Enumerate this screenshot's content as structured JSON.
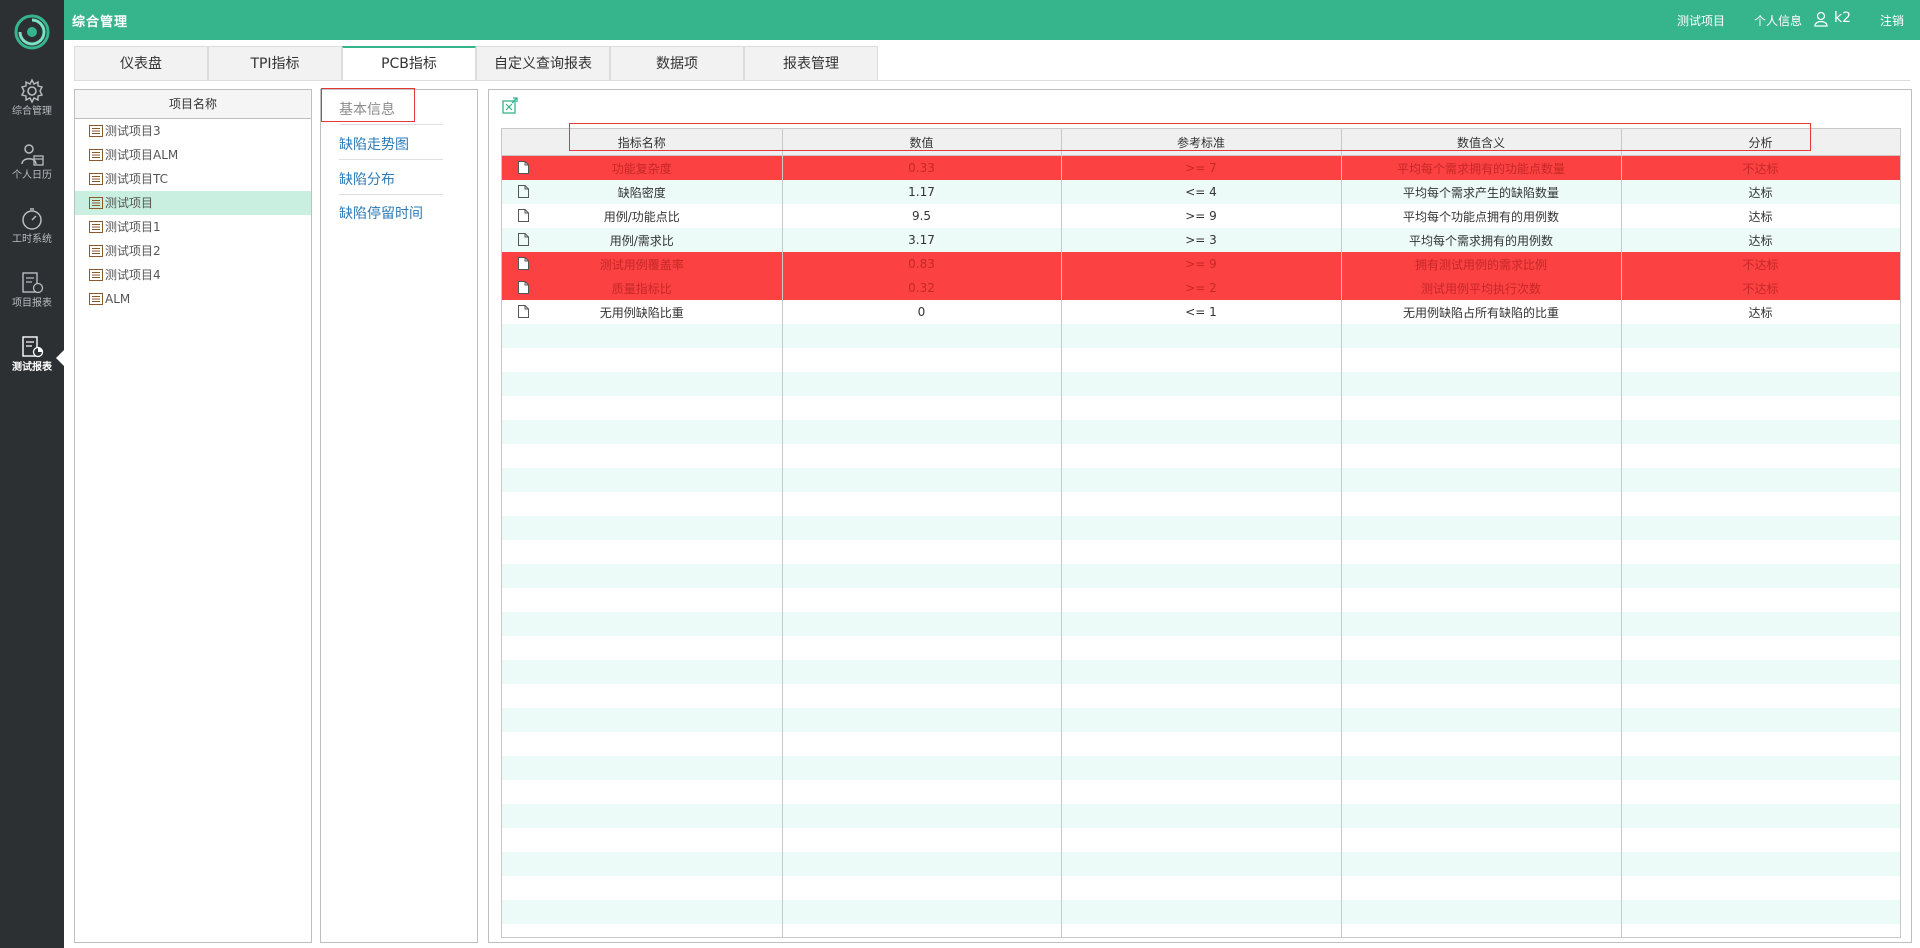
{
  "app": {
    "title": "综合管理"
  },
  "nav": {
    "items": [
      {
        "label": "综合管理",
        "icon": "gear-icon"
      },
      {
        "label": "个人日历",
        "icon": "person-calendar-icon"
      },
      {
        "label": "工时系统",
        "icon": "stopwatch-icon"
      },
      {
        "label": "项目报表",
        "icon": "project-report-icon"
      },
      {
        "label": "测试报表",
        "icon": "test-report-icon",
        "active": true
      }
    ]
  },
  "topbar": {
    "project": "测试项目",
    "profile": "个人信息",
    "username": "k2",
    "logout": "注销"
  },
  "tabs": [
    {
      "label": "仪表盘"
    },
    {
      "label": "TPI指标"
    },
    {
      "label": "PCB指标",
      "active": true
    },
    {
      "label": "自定义查询报表"
    },
    {
      "label": "数据项"
    },
    {
      "label": "报表管理"
    }
  ],
  "projects": {
    "header": "项目名称",
    "items": [
      "测试项目3",
      "测试项目ALM",
      "测试项目TC",
      "测试项目",
      "测试项目1",
      "测试项目2",
      "测试项目4",
      "ALM"
    ],
    "selected": "测试项目"
  },
  "submenu": {
    "items": [
      {
        "label": "基本信息",
        "current": true
      },
      {
        "label": "缺陷走势图"
      },
      {
        "label": "缺陷分布"
      },
      {
        "label": "缺陷停留时间"
      }
    ]
  },
  "table": {
    "columns": [
      "指标名称",
      "数值",
      "参考标准",
      "数值含义",
      "分析"
    ],
    "rows": [
      {
        "name": "功能复杂度",
        "value": "0.33",
        "standard": ">= 7",
        "meaning": "平均每个需求拥有的功能点数量",
        "analysis": "不达标",
        "fail": true
      },
      {
        "name": "缺陷密度",
        "value": "1.17",
        "standard": "<= 4",
        "meaning": "平均每个需求产生的缺陷数量",
        "analysis": "达标",
        "fail": false
      },
      {
        "name": "用例/功能点比",
        "value": "9.5",
        "standard": ">= 9",
        "meaning": "平均每个功能点拥有的用例数",
        "analysis": "达标",
        "fail": false
      },
      {
        "name": "用例/需求比",
        "value": "3.17",
        "standard": ">= 3",
        "meaning": "平均每个需求拥有的用例数",
        "analysis": "达标",
        "fail": false
      },
      {
        "name": "测试用例覆盖率",
        "value": "0.83",
        "standard": ">= 9",
        "meaning": "拥有测试用例的需求比例",
        "analysis": "不达标",
        "fail": true
      },
      {
        "name": "质量指标比",
        "value": "0.32",
        "standard": ">= 2",
        "meaning": "测试用例平均执行次数",
        "analysis": "不达标",
        "fail": true
      },
      {
        "name": "无用例缺陷比重",
        "value": "0",
        "standard": "<= 1",
        "meaning": "无用例缺陷占所有缺陷的比重",
        "analysis": "达标",
        "fail": false
      }
    ]
  },
  "colors": {
    "accent": "#36b48c",
    "fail": "#fb4141",
    "link": "#2b7bb8",
    "rail": "#2c3033"
  }
}
